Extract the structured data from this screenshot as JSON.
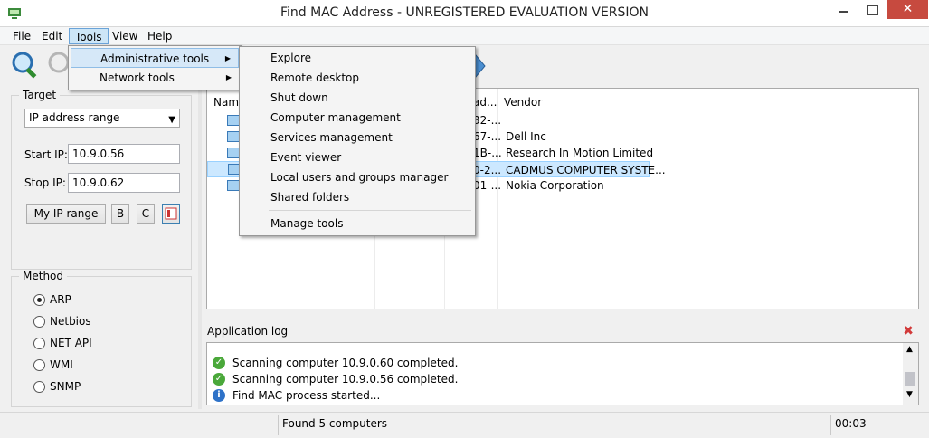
{
  "window": {
    "title": "Find MAC Address - UNREGISTERED EVALUATION VERSION",
    "close_glyph": "✕"
  },
  "menu": [
    {
      "label": "File"
    },
    {
      "label": "Edit"
    },
    {
      "label": "Tools"
    },
    {
      "label": "View"
    },
    {
      "label": "Help"
    }
  ],
  "target": {
    "group_label": "Target",
    "mode": "IP address range",
    "start_label": "Start IP:",
    "start_value": "10.9.0.56",
    "stop_label": "Stop IP:",
    "stop_value": "10.9.0.62",
    "my_ip_button": "My IP range",
    "b_button": "B",
    "c_button": "C"
  },
  "method": {
    "group_label": "Method",
    "options": [
      {
        "label": "ARP",
        "checked": true
      },
      {
        "label": "Netbios",
        "checked": false
      },
      {
        "label": "NET API",
        "checked": false
      },
      {
        "label": "WMI",
        "checked": false
      },
      {
        "label": "SNMP",
        "checked": false
      }
    ]
  },
  "results": {
    "columns": {
      "name": "Name",
      "mac": "ad...",
      "vendor": "Vendor"
    },
    "rows": [
      {
        "mac": "32-...",
        "vendor": ""
      },
      {
        "mac": "67-...",
        "vendor": "Dell Inc"
      },
      {
        "mac": "1B-...",
        "vendor": "Research In Motion Limited"
      },
      {
        "mac": "0-2...",
        "vendor": "CADMUS COMPUTER SYSTE...",
        "selected": true
      },
      {
        "mac": "01-...",
        "vendor": "Nokia Corporation"
      }
    ]
  },
  "log": {
    "title": "Application log",
    "clear_glyph": "✖",
    "entries": [
      {
        "type": "ok",
        "text": "Scanning computer 10.9.0.60 completed."
      },
      {
        "type": "ok",
        "text": "Scanning computer 10.9.0.56 completed."
      },
      {
        "type": "info",
        "text": "Find MAC process started..."
      }
    ]
  },
  "status": {
    "message": "Found 5 computers",
    "time": "00:03"
  },
  "tools_menu": {
    "items": [
      {
        "label": "Administrative tools",
        "highlighted": true
      },
      {
        "label": "Network tools",
        "highlighted": false
      }
    ],
    "submenu_arrow": "▶"
  },
  "admin_submenu": {
    "items": [
      "Explore",
      "Remote desktop",
      "Shut down",
      "Computer management",
      "Services management",
      "Event viewer",
      "Local users and groups manager",
      "Shared folders"
    ],
    "footer_item": "Manage tools"
  },
  "colors": {
    "accent": "#cde6f7",
    "close_btn": "#c74a3f",
    "selection": "#cce8ff"
  }
}
